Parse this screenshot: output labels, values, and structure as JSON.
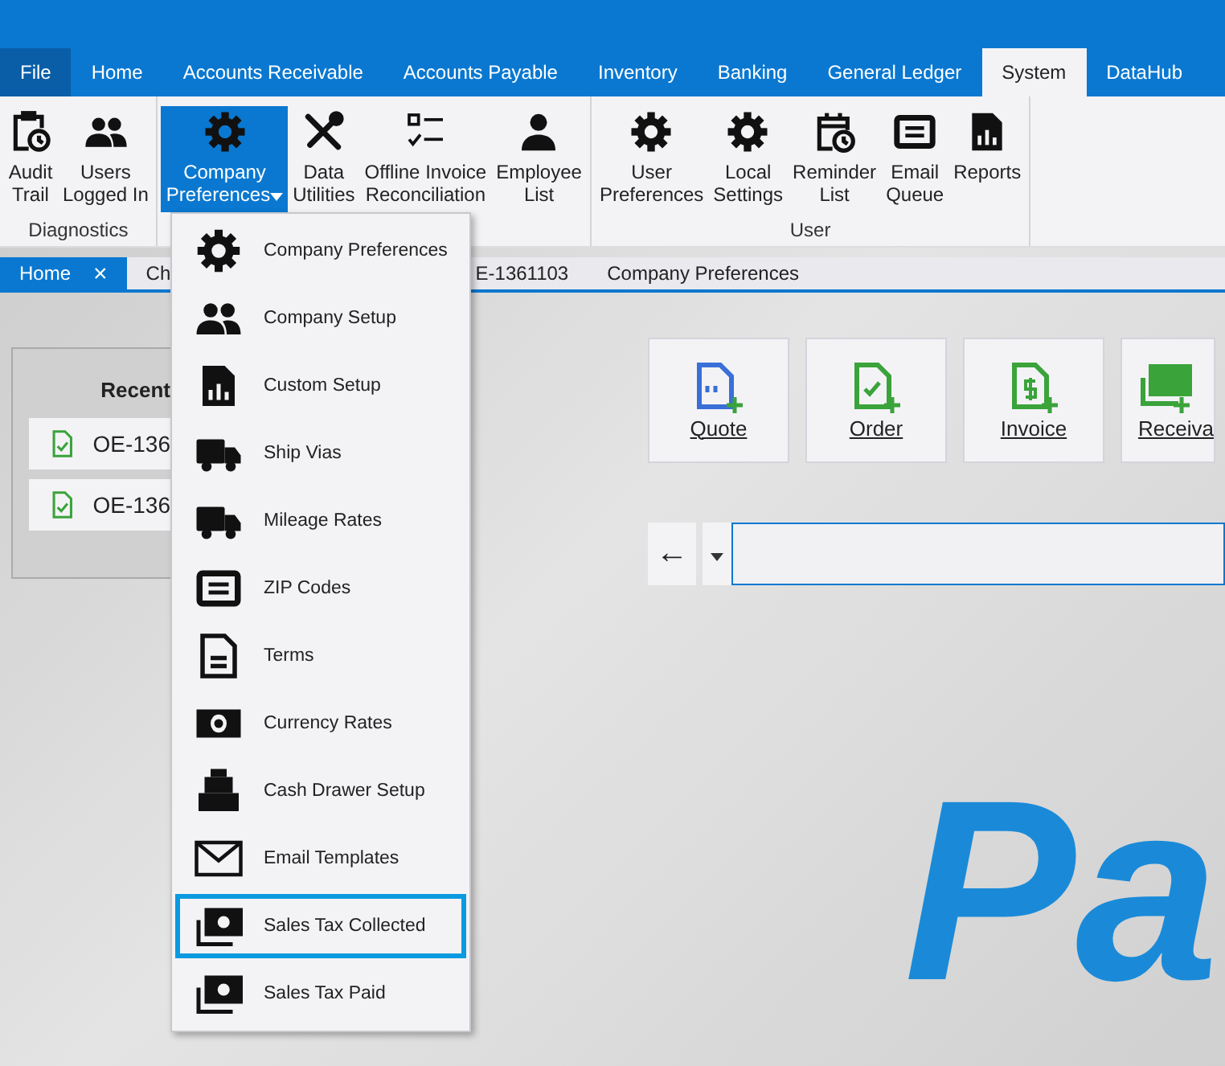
{
  "menu_tabs": [
    {
      "label": "File",
      "kind": "file",
      "selected": false
    },
    {
      "label": "Home",
      "kind": "tab",
      "selected": false
    },
    {
      "label": "Accounts Receivable",
      "kind": "tab",
      "selected": false
    },
    {
      "label": "Accounts Payable",
      "kind": "tab",
      "selected": false
    },
    {
      "label": "Inventory",
      "kind": "tab",
      "selected": false
    },
    {
      "label": "Banking",
      "kind": "tab",
      "selected": false
    },
    {
      "label": "General Ledger",
      "kind": "tab",
      "selected": false
    },
    {
      "label": "System",
      "kind": "tab",
      "selected": true
    },
    {
      "label": "DataHub",
      "kind": "tab",
      "selected": false
    }
  ],
  "ribbon_groups": [
    {
      "label": "Diagnostics",
      "buttons": [
        {
          "lines": [
            "Audit",
            "Trail"
          ],
          "selected": false,
          "dropdown": false
        },
        {
          "lines": [
            "Users",
            "Logged In"
          ],
          "selected": false,
          "dropdown": false
        }
      ]
    },
    {
      "buttons": [
        {
          "lines": [
            "Company",
            "Preferences"
          ],
          "selected": true,
          "dropdown": true
        },
        {
          "lines": [
            "Data",
            "Utilities"
          ],
          "selected": false,
          "dropdown": false
        },
        {
          "lines": [
            "Offline Invoice",
            "Reconciliation"
          ],
          "selected": false,
          "dropdown": false
        },
        {
          "lines": [
            "Employee",
            "List"
          ],
          "selected": false,
          "dropdown": false
        }
      ]
    },
    {
      "label": "User",
      "buttons": [
        {
          "lines": [
            "User",
            "Preferences"
          ],
          "selected": false,
          "dropdown": false
        },
        {
          "lines": [
            "Local",
            "Settings"
          ],
          "selected": false,
          "dropdown": false
        },
        {
          "lines": [
            "Reminder",
            "List"
          ],
          "selected": false,
          "dropdown": false
        },
        {
          "lines": [
            "Email",
            "Queue"
          ],
          "selected": false,
          "dropdown": false
        },
        {
          "lines": [
            "Reports"
          ],
          "selected": false,
          "dropdown": false
        }
      ]
    }
  ],
  "doc_tabs": [
    {
      "label": "Home",
      "selected": true,
      "close": "×"
    },
    {
      "label": "Ch",
      "selected": false
    },
    {
      "label": "E-1361103",
      "selected": false
    },
    {
      "label": "Company Preferences",
      "selected": false
    }
  ],
  "recent": {
    "title": "Recent",
    "items": [
      "OE-136",
      "OE-136"
    ]
  },
  "quick_buttons": [
    {
      "label": "Quote",
      "kind": "quote"
    },
    {
      "label": "Order",
      "kind": "order"
    },
    {
      "label": "Invoice",
      "kind": "invoice"
    },
    {
      "label": "Receiva",
      "kind": "receivable"
    }
  ],
  "nav": {
    "back": "←"
  },
  "logo": "Pa",
  "dropdown_menu": [
    {
      "label": "Company Preferences",
      "selected": false
    },
    {
      "label": "Company Setup",
      "selected": false
    },
    {
      "label": "Custom Setup",
      "selected": false
    },
    {
      "label": "Ship Vias",
      "selected": false
    },
    {
      "label": "Mileage Rates",
      "selected": false
    },
    {
      "label": "ZIP Codes",
      "selected": false
    },
    {
      "label": "Terms",
      "selected": false
    },
    {
      "label": "Currency Rates",
      "selected": false
    },
    {
      "label": "Cash Drawer Setup",
      "selected": false
    },
    {
      "label": "Email Templates",
      "selected": false
    },
    {
      "label": "Sales Tax Collected",
      "selected": true
    },
    {
      "label": "Sales Tax Paid",
      "selected": false
    }
  ]
}
